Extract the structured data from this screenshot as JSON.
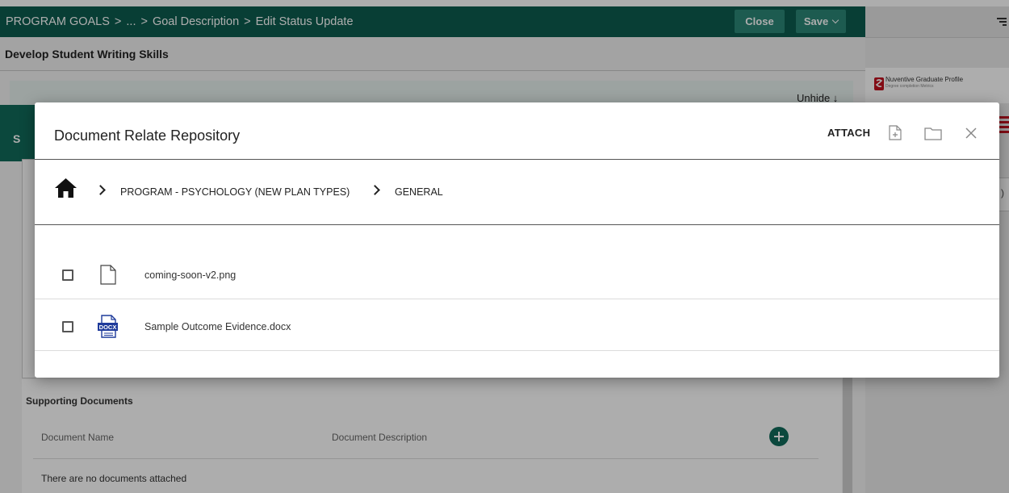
{
  "app": {
    "breadcrumb": [
      "PROGRAM GOALS",
      ">",
      "...",
      ">",
      "Goal Description",
      ">",
      "Edit Status Update"
    ],
    "close_label": "Close",
    "save_label": "Save",
    "goal_title": "Develop Student Writing Skills",
    "unhide_label": "Unhide ↓",
    "section_letters": "S",
    "supporting_docs": {
      "title": "Supporting Documents",
      "col_name": "Document Name",
      "col_desc": "Document Description",
      "empty_text": "There are no documents attached"
    },
    "right_panel": {
      "card_title": "Nuventive Graduate Profile",
      "card_subtitle": "Degree completion Metrics",
      "partial_text": ")"
    }
  },
  "modal": {
    "title": "Document Relate Repository",
    "attach_label": "ATTACH",
    "breadcrumb": {
      "sep1": ">",
      "item1": "PROGRAM - PSYCHOLOGY (NEW PLAN TYPES)",
      "sep2": ">",
      "item2": "GENERAL"
    },
    "files": [
      {
        "name": "coming-soon-v2.png",
        "icon": "file-icon",
        "checked": false
      },
      {
        "name": "Sample Outcome Evidence.docx",
        "icon": "docx-icon",
        "checked": false
      }
    ],
    "docx_badge": "DOCX"
  },
  "colors": {
    "brand_green": "#0d5c4f",
    "button_green": "#2c8677",
    "accent_red": "#c1121f",
    "docx_blue": "#1f3b9b"
  }
}
